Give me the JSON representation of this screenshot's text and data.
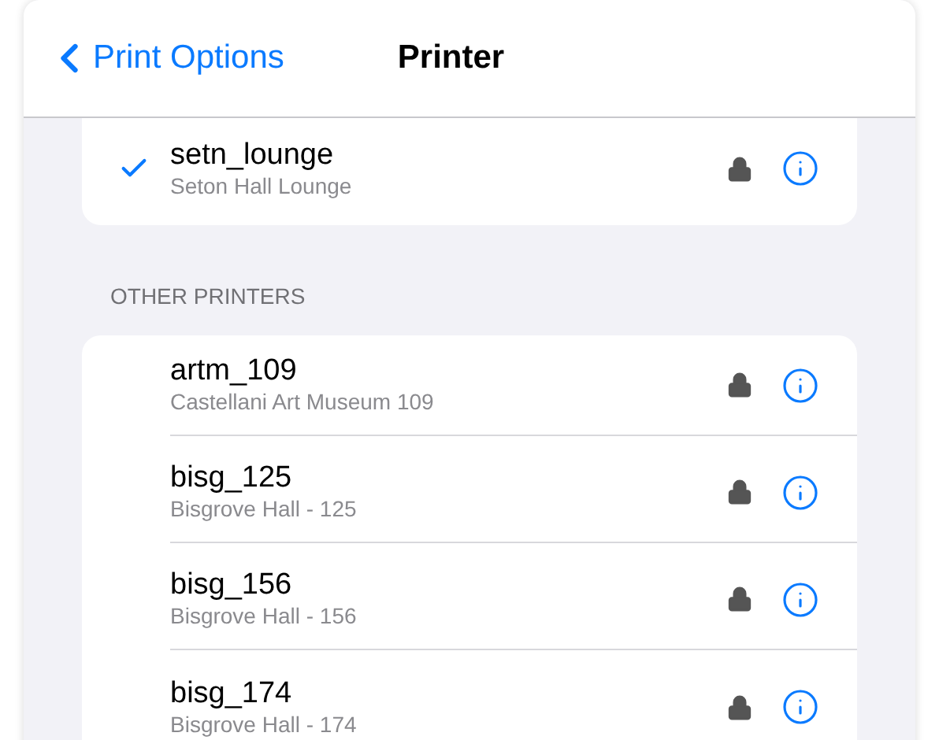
{
  "header": {
    "back_label": "Print Options",
    "title": "Printer"
  },
  "current_printers": [
    {
      "name": "setn_lounge",
      "location": "Seton Hall Lounge",
      "selected": true
    }
  ],
  "other_section": {
    "heading": "OTHER PRINTERS",
    "printers": [
      {
        "name": "artm_109",
        "location": "Castellani Art Museum 109",
        "selected": false
      },
      {
        "name": "bisg_125",
        "location": "Bisgrove Hall - 125",
        "selected": false
      },
      {
        "name": "bisg_156",
        "location": "Bisgrove Hall - 156",
        "selected": false
      },
      {
        "name": "bisg_174",
        "location": "Bisgrove Hall - 174",
        "selected": false
      }
    ]
  }
}
